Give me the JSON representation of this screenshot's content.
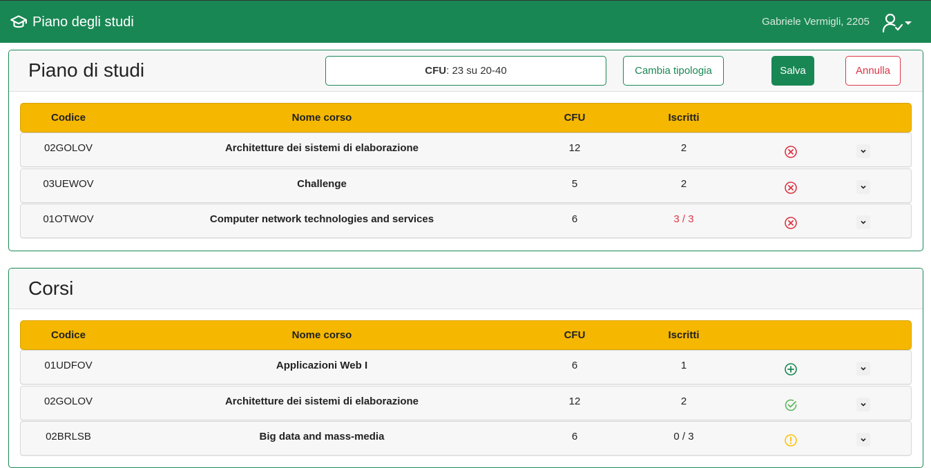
{
  "navbar": {
    "brand": "Piano degli studi",
    "user": "Gabriele Vermigli, 2205"
  },
  "plan": {
    "title": "Piano di studi",
    "cfu_label": "CFU",
    "cfu_value": ": 23 su 20-40",
    "change_type": "Cambia tipologia",
    "save": "Salva",
    "cancel": "Annulla",
    "headers": [
      "Codice",
      "Nome corso",
      "CFU",
      "Iscritti"
    ],
    "rows": [
      {
        "code": "02GOLOV",
        "name": "Architetture dei sistemi di elaborazione",
        "cfu": "12",
        "enrolled": "2",
        "action": "remove-icon"
      },
      {
        "code": "03UEWOV",
        "name": "Challenge",
        "cfu": "5",
        "enrolled": "2",
        "action": "remove-icon"
      },
      {
        "code": "01OTWOV",
        "name": "Computer network technologies and services",
        "cfu": "6",
        "enrolled": "3 / 3",
        "action": "remove-icon"
      }
    ]
  },
  "courses": {
    "title": "Corsi",
    "headers": [
      "Codice",
      "Nome corso",
      "CFU",
      "Iscritti"
    ],
    "rows": [
      {
        "code": "01UDFOV",
        "name": "Applicazioni Web I",
        "cfu": "6",
        "enrolled": "1",
        "action": "add-icon"
      },
      {
        "code": "02GOLOV",
        "name": "Architetture dei sistemi di elaborazione",
        "cfu": "12",
        "enrolled": "2",
        "action": "check-icon"
      },
      {
        "code": "02BRLSB",
        "name": "Big data and mass-media",
        "cfu": "6",
        "enrolled": "0 / 3",
        "action": "warning-icon"
      }
    ]
  },
  "colors": {
    "primary": "#198754",
    "header_row": "#f5b700",
    "danger": "#dc3545",
    "warning": "#ffc107"
  }
}
